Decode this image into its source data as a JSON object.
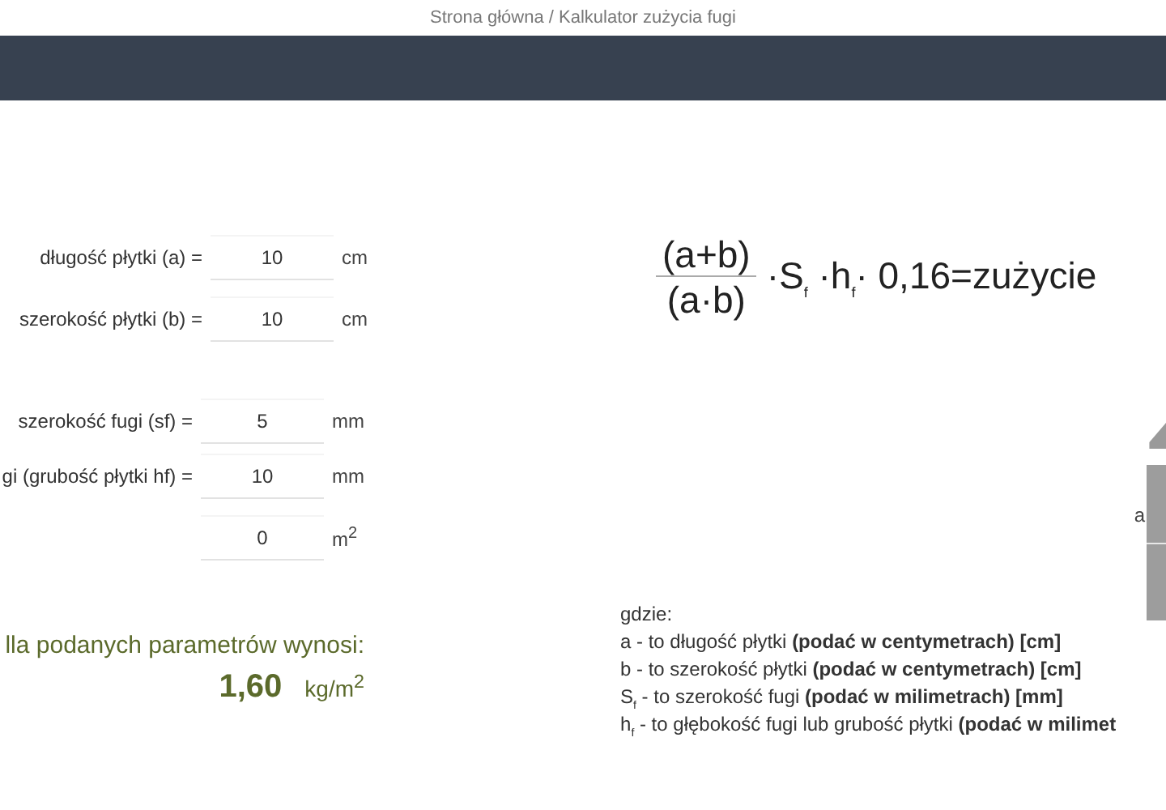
{
  "breadcrumb": "Strona główna / Kalkulator zużycia fugi",
  "tile_fields": [
    {
      "label": "długość płytki (a) =",
      "value": "10",
      "unit": "cm"
    },
    {
      "label": "szerokość płytki (b) =",
      "value": "10",
      "unit": "cm"
    }
  ],
  "joint_fields": [
    {
      "label": "szerokość fugi (sf) =",
      "value": "5",
      "unit": "mm"
    },
    {
      "label": "gi (grubość płytki hf) =",
      "value": "10",
      "unit": "mm"
    },
    {
      "value": "0",
      "unit": "m$^{2}$"
    }
  ],
  "result": {
    "label": "lla podanych parametrów wynosi:",
    "value": "1,60",
    "unit": "kg/m$^{2}$"
  },
  "formula": {
    "numerator": "(a+b)",
    "denominator": "(a·b)",
    "rest": "·S$_{f}$ ·h$_{f}$· 0,16=zużycie"
  },
  "diagram_label": "a",
  "legend": [
    "gdzie:",
    "a - to długość płytki **(podać w centymetrach) [cm]**",
    "b - to szerokość płytki **(podać w centymetrach) [cm]**",
    "S$_{f}$ - to szerokość fugi **(podać w milimetrach) [mm]**",
    "h$_{f}$ - to głębokość fugi lub grubość płytki **(podać w milimet**"
  ]
}
